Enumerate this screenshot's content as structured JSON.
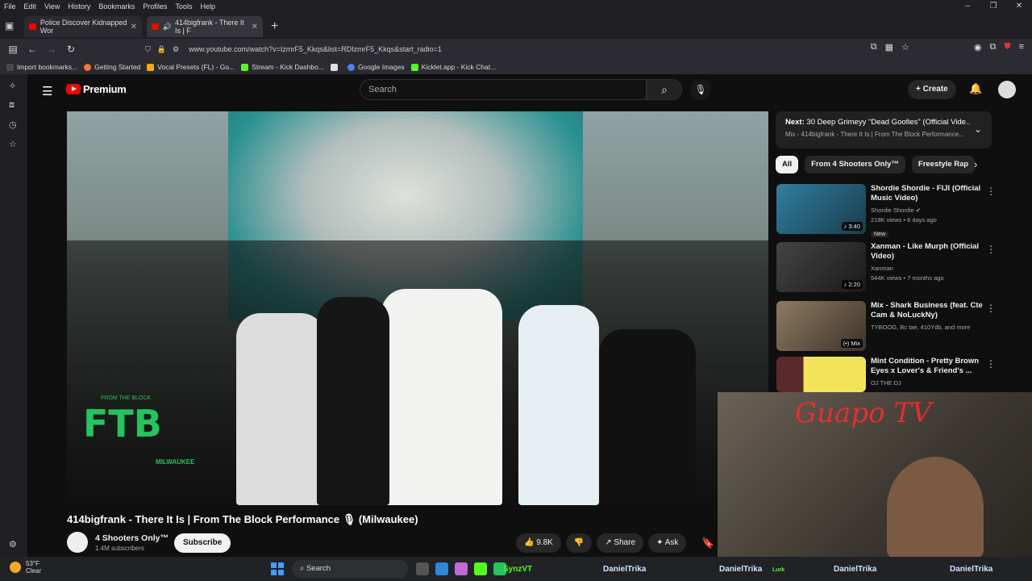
{
  "menubar": [
    "File",
    "Edit",
    "View",
    "History",
    "Bookmarks",
    "Profiles",
    "Tools",
    "Help"
  ],
  "window_controls": [
    "–",
    "❐",
    "✕"
  ],
  "tabs": [
    {
      "title": "Police Discover Kidnapped Wor",
      "close": "✕"
    },
    {
      "title": "414bigfrank - There It Is | F",
      "close": "✕"
    }
  ],
  "new_tab": "+",
  "address": {
    "url": "www.youtube.com/watch?v=IzmrF5_Kkqs&list=RDIzmrF5_Kkqs&start_radio=1"
  },
  "bookmarks": [
    {
      "label": "Import bookmarks...",
      "color": "#4a4a4a"
    },
    {
      "label": "Getting Started",
      "color": "#ff7139"
    },
    {
      "label": "Vocal Presets (FL) - Go...",
      "color": "#f9ab00"
    },
    {
      "label": "Stream - Kick Dashbo...",
      "color": "#53fc18"
    },
    {
      "label": "",
      "color": "#e0e0e0"
    },
    {
      "label": "Google Images",
      "color": "#4285f4"
    },
    {
      "label": "Kicklet.app - Kick Chat...",
      "color": "#53fc18"
    }
  ],
  "youtube": {
    "logo": "Premium",
    "search_placeholder": "Search",
    "create": "+ Create"
  },
  "video": {
    "overlay_logo": "FTB",
    "overlay_small": "FROM THE BLOCK",
    "overlay_city": "MILWAUKEE",
    "title": "414bigfrank - There It Is | From The Block Performance 🎙 (Milwaukee)",
    "channel": "4 Shooters Only™",
    "subscribers": "1.4M subscribers",
    "subscribe": "Subscribe",
    "likes": "👍 9.8K",
    "dislike": "👎",
    "share": "↗ Share",
    "ask": "✦ Ask"
  },
  "next": {
    "label": "Next:",
    "title": "30 Deep Grimeyy \"Dead Goofies\" (Official Vide...",
    "subtitle": "Mix - 414bigfrank - There It Is | From The Block Performance..."
  },
  "chips": [
    "All",
    "From 4 Shooters Only™",
    "Freestyle Rap"
  ],
  "recommendations": [
    {
      "title": "Shordie Shordie - FIJI (Official Music Video)",
      "channel": "Shordie Shordie ✔",
      "meta": "218K views • 6 days ago",
      "badge": "New",
      "duration": "♪ 3:40",
      "thumb": "#2f7fa0"
    },
    {
      "title": "Xanman - Like Murph (Official Video)",
      "channel": "Xanman",
      "meta": "544K views • 7 months ago",
      "badge": "",
      "duration": "♪ 2:20",
      "thumb": "#3a3a3a"
    },
    {
      "title": "Mix - Shark Business (feat. Cte Cam & NoLuckNy)",
      "channel": "TYBOOG, Bc tae, 410Ydb, and more",
      "meta": "",
      "badge": "",
      "duration": "(•) Mix",
      "thumb": "#7a6a58"
    },
    {
      "title": "Mint Condition - Pretty Brown Eyes x Lover's & Friend's ...",
      "channel": "OJ THE DJ",
      "meta": "",
      "badge": "",
      "duration": "",
      "thumb": "#e8d84a"
    }
  ],
  "webcam": {
    "overlay_text": "Guapo TV"
  },
  "taskbar": {
    "temp": "53°F",
    "condition": "Clear",
    "search": "Search",
    "overlay_names": [
      "SynzVT",
      "DanielTrika",
      "DanielTrika",
      "DanielTrika",
      "DanielTrika"
    ],
    "lurk": "Lurk"
  }
}
